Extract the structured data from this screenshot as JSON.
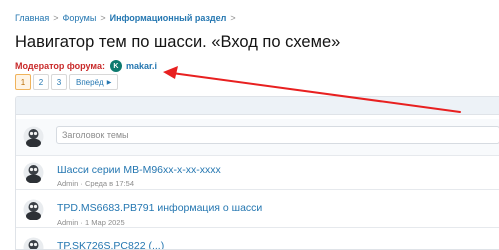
{
  "breadcrumb": {
    "items": [
      "Главная",
      "Форумы",
      "Информационный раздел"
    ],
    "separator": ">"
  },
  "page_title": "Навигатор тем по шасси. «Вход по схеме»",
  "moderator": {
    "label": "Модератор форума:",
    "avatar_letter": "K",
    "name": "makar.i"
  },
  "pager": {
    "pages": [
      "1",
      "2",
      "3"
    ],
    "current": "1",
    "next_label": "Вперёд"
  },
  "new_thread": {
    "placeholder": "Заголовок темы"
  },
  "threads": [
    {
      "title": "Шасси серии MB-M96xx-x-xx-xxxx",
      "author": "Admin",
      "date": "Среда в 17:54"
    },
    {
      "title": "TPD.MS6683.PB791 информация о шасси",
      "author": "Admin",
      "date": "1 Мар 2025"
    },
    {
      "title": "TP.SK726S.PC822 (...)",
      "author": "",
      "date": ""
    }
  ],
  "colors": {
    "link": "#2577b1",
    "moderator_label": "#c92b2b",
    "annotation_arrow": "#e82020",
    "header_band": "#edf2f7"
  }
}
